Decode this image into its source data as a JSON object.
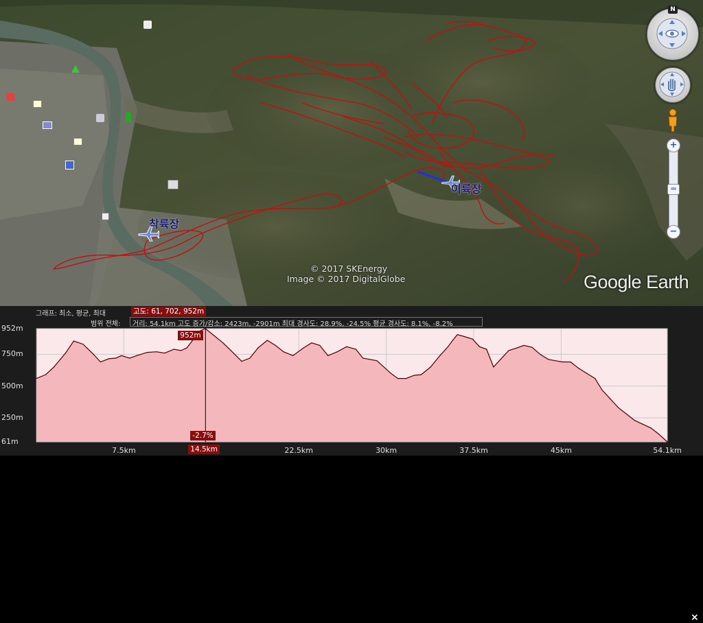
{
  "map": {
    "credits": [
      "© 2017 SKEnergy",
      "Image © 2017 DigitalGlobe"
    ],
    "logo": "Google Earth",
    "compass_letter": "N",
    "placemarks": [
      {
        "label": "착륙장",
        "icon": "airport-icon"
      },
      {
        "label": "이륙장",
        "icon": "airport-icon"
      }
    ],
    "track_color": "#c01010",
    "controls": {
      "look_icon": "eye-icon",
      "move_icon": "hand-icon",
      "streetview_icon": "pegman-icon",
      "zoom_in": "+",
      "zoom_out": "−"
    }
  },
  "elevation_panel": {
    "graph_label": "그래프: 최소, 평균, 최대",
    "graph_values": "고도: 61, 702, 952m",
    "range_label": "범위 전체:",
    "range_values": "거리: 54.1km  고도 증가/감소: 2423m, -2901m  최대 경사도: 28.9%, -24.5%  평균 경사도: 8.1%, -8.2%",
    "hover_elevation": "952m",
    "hover_slope": "-2.7%",
    "hover_distance": "14.5km",
    "close_label": "×"
  },
  "chart_data": {
    "type": "area",
    "title": "",
    "xlabel": "",
    "ylabel": "",
    "x_unit": "km",
    "y_unit": "m",
    "xlim": [
      0,
      54.1
    ],
    "ylim": [
      61,
      952
    ],
    "y_ticks": [
      {
        "value": 952,
        "label": "952m"
      },
      {
        "value": 750,
        "label": "750m"
      },
      {
        "value": 500,
        "label": "500m"
      },
      {
        "value": 250,
        "label": "250m"
      },
      {
        "value": 61,
        "label": "61m"
      }
    ],
    "x_ticks": [
      {
        "value": 7.5,
        "label": "7.5km"
      },
      {
        "value": 14.5,
        "label": "14.5km",
        "highlight": true
      },
      {
        "value": 22.5,
        "label": "22.5km"
      },
      {
        "value": 30,
        "label": "30km"
      },
      {
        "value": 37.5,
        "label": "37.5km"
      },
      {
        "value": 45,
        "label": "45km"
      },
      {
        "value": 54.1,
        "label": "54.1km"
      }
    ],
    "cursor_x": 14.5,
    "grid": true,
    "fill_color": "#f4b8bc",
    "line_color": "#4a0000",
    "x": [
      0,
      0.8,
      1.5,
      2.5,
      3.2,
      4.0,
      4.9,
      5.5,
      6.2,
      6.8,
      7.3,
      8.0,
      8.6,
      9.5,
      10.3,
      11.0,
      11.8,
      12.4,
      12.9,
      13.4,
      13.9,
      14.5,
      15.2,
      16.0,
      16.9,
      17.6,
      18.3,
      19.0,
      19.8,
      20.5,
      21.2,
      22.0,
      22.9,
      23.6,
      24.3,
      25.0,
      25.8,
      26.6,
      27.4,
      28.0,
      28.6,
      29.2,
      29.8,
      30.4,
      31.0,
      31.7,
      32.4,
      33.0,
      33.8,
      34.6,
      35.3,
      35.7,
      36.1,
      36.7,
      37.4,
      38.0,
      38.6,
      39.2,
      39.8,
      40.5,
      41.2,
      41.8,
      42.5,
      43.2,
      43.9,
      44.5,
      45.1,
      45.8,
      46.5,
      47.2,
      47.9,
      48.5,
      49.2,
      49.9,
      50.6,
      51.3,
      52.0,
      52.7,
      53.4,
      54.1
    ],
    "y": [
      560,
      590,
      650,
      760,
      855,
      830,
      750,
      690,
      715,
      720,
      740,
      720,
      740,
      765,
      770,
      760,
      790,
      780,
      800,
      860,
      930,
      952,
      900,
      840,
      760,
      695,
      720,
      800,
      860,
      820,
      770,
      740,
      800,
      840,
      820,
      740,
      770,
      810,
      790,
      720,
      710,
      700,
      650,
      600,
      560,
      560,
      585,
      590,
      650,
      740,
      810,
      860,
      905,
      890,
      870,
      810,
      790,
      650,
      710,
      780,
      800,
      820,
      805,
      750,
      710,
      700,
      690,
      690,
      640,
      600,
      560,
      470,
      400,
      330,
      280,
      230,
      200,
      170,
      120,
      61
    ]
  }
}
